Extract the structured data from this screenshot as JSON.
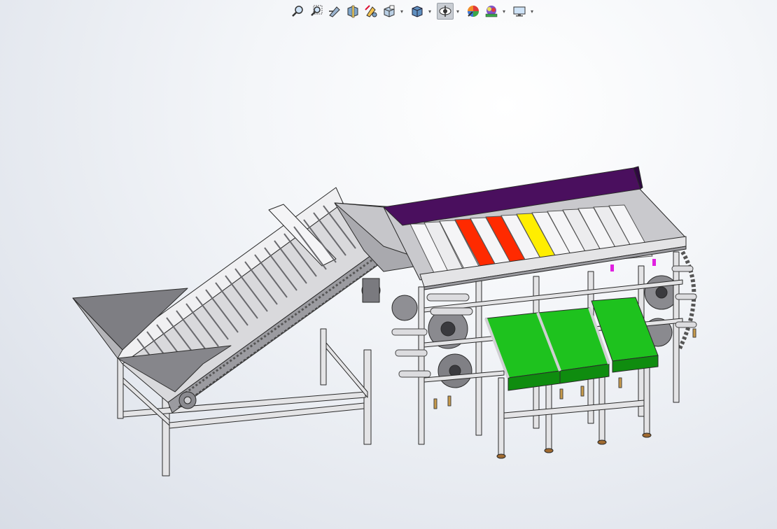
{
  "toolbar": {
    "items": [
      {
        "icon": "zoom-to-fit-icon",
        "dropdown": false
      },
      {
        "icon": "zoom-to-area-icon",
        "dropdown": false
      },
      {
        "icon": "previous-view-icon",
        "dropdown": false
      },
      {
        "icon": "section-view-icon",
        "dropdown": false
      },
      {
        "icon": "dynamic-annotation-icon",
        "dropdown": false
      },
      {
        "icon": "view-orientation-icon",
        "dropdown": true
      },
      {
        "icon": "display-style-icon",
        "dropdown": true
      },
      {
        "icon": "hide-show-items-icon",
        "dropdown": true,
        "active": true
      },
      {
        "icon": "edit-appearance-icon",
        "dropdown": false
      },
      {
        "icon": "apply-scene-icon",
        "dropdown": true
      },
      {
        "icon": "view-settings-icon",
        "dropdown": true
      }
    ]
  },
  "colors": {
    "frame": "#e4e4e6",
    "frame_edge": "#2a2a2a",
    "belt_green": "#1ec21e",
    "cover_purple": "#4a0f5e",
    "roller_red": "#ff2a00",
    "roller_yellow": "#ffee00",
    "accent_magenta": "#e020e0"
  }
}
